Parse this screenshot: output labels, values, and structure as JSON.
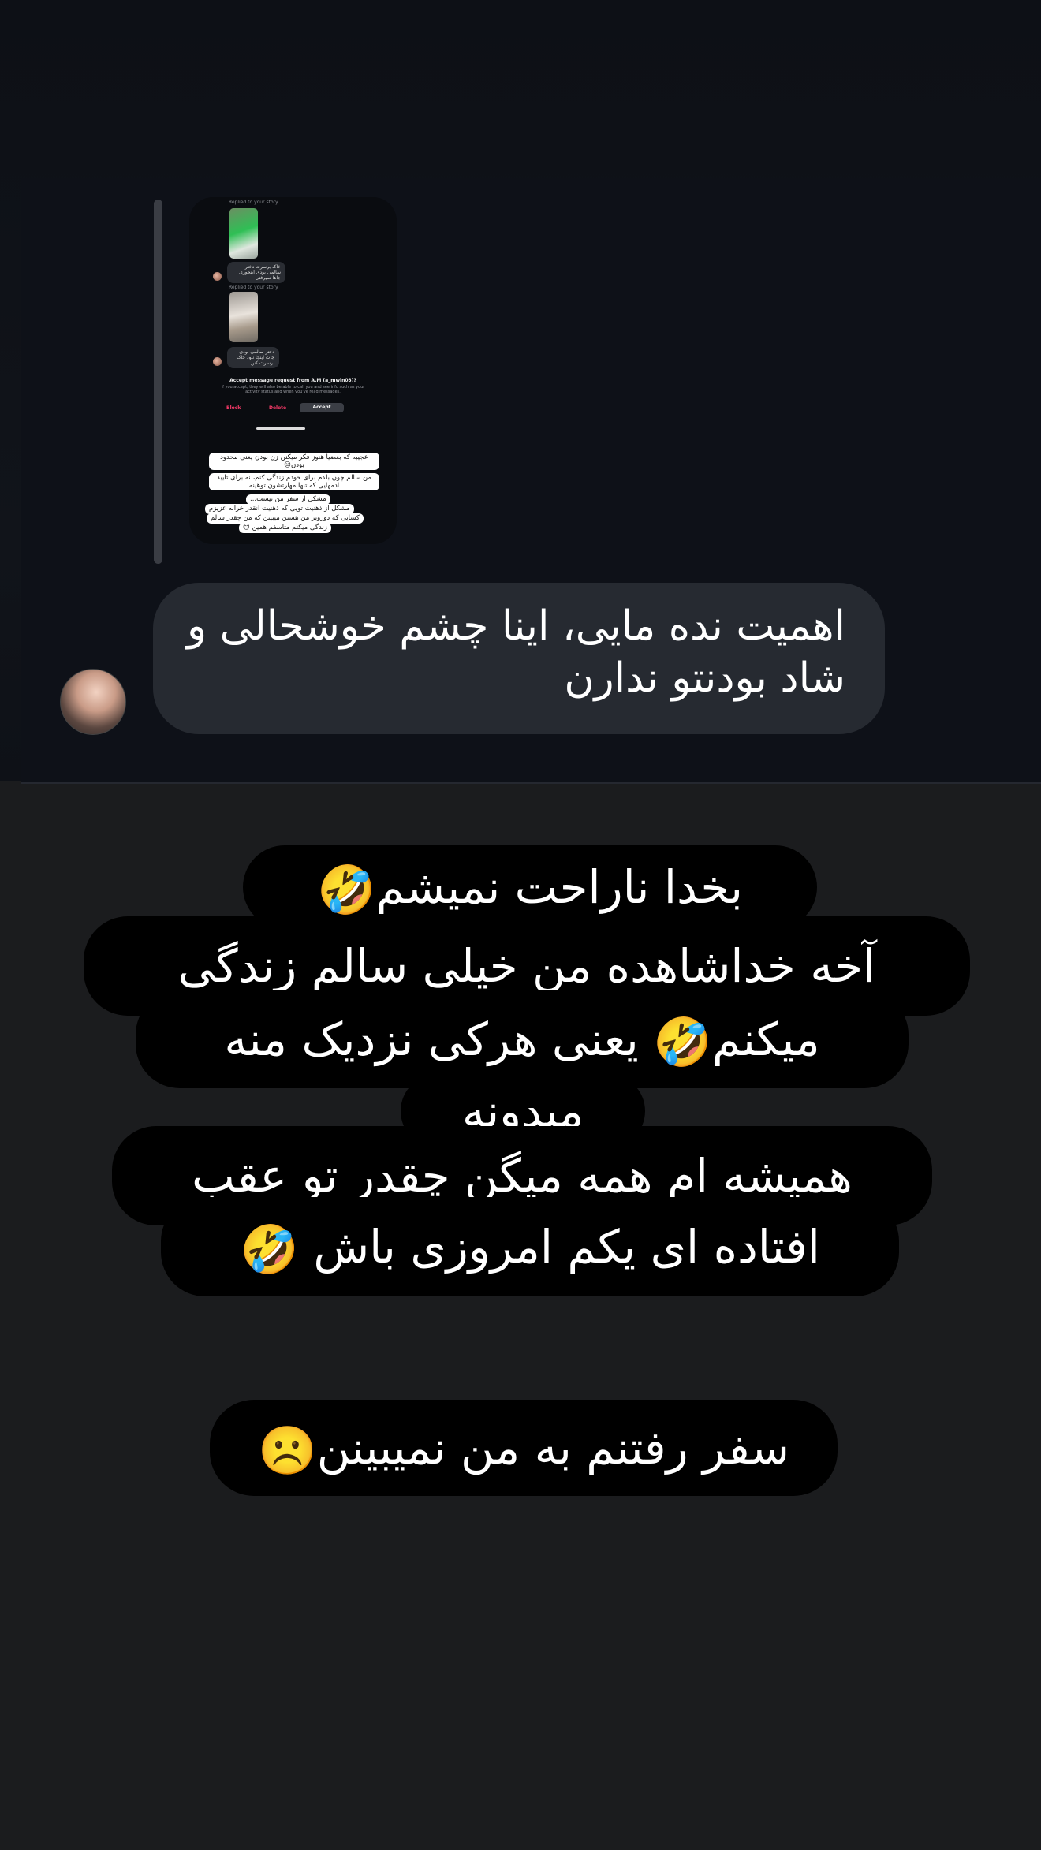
{
  "top_screenshot": {
    "nested": {
      "replied_label_1": "Replied to your story",
      "reply_1": "خاک برسرت دختر سالمی بودی اینجوری جاها نمیرفتی",
      "replied_label_2": "Replied to your story",
      "reply_2": "دختر سالمی بودی جات اینجا نبود خاک برسرت کنن",
      "request_title": "Accept message request from A.M (a_mwin03)?",
      "request_subtitle": "If you accept, they will also be able to call you and see info such as your activity status and when you've read messages.",
      "block_label": "Block",
      "delete_label": "Delete",
      "accept_label": "Accept",
      "captions": [
        "عجیبه که بعضیا هنوز فکر میکنن زن بودن یعنی محدود بودن😑",
        "من سالم چون بلدم برای خودم زندگی کنم، نه برای تایید ادمهایی که تنها مهارتشون توهینه",
        "مشکل از سفر من نیست...",
        "مشکل از ذهنیت تویی که ذهنیت انقدر خرابه عزیزم",
        "کسایی که دوروبر من هستن میبینن که من چقدر سالم",
        "زندگی میکنم متاسفم همین 😊"
      ]
    },
    "reply_text": "اهمیت نده مایی، اینا چشم خوشحالی و\nشاد بودنتو ندارن"
  },
  "story_lines": [
    {
      "text": "بخدا ناراحت نمیشم",
      "emoji": "🤣"
    },
    {
      "text": "آخه خداشاهده من خیلی سالم زندگی"
    },
    {
      "text": "یعنی هرکی نزدیک منه",
      "emoji": "🤣",
      "text_after": "میکنم"
    },
    {
      "text": "میدونه"
    },
    {
      "text": "همیشه ام همه میگن چقدر تو عقب"
    },
    {
      "text": "افتاده ای یکم امروزی باش",
      "emoji": "🤣"
    },
    {
      "text": "سفر رفتنم به من نمیبینن",
      "emoji": "☹️"
    }
  ]
}
